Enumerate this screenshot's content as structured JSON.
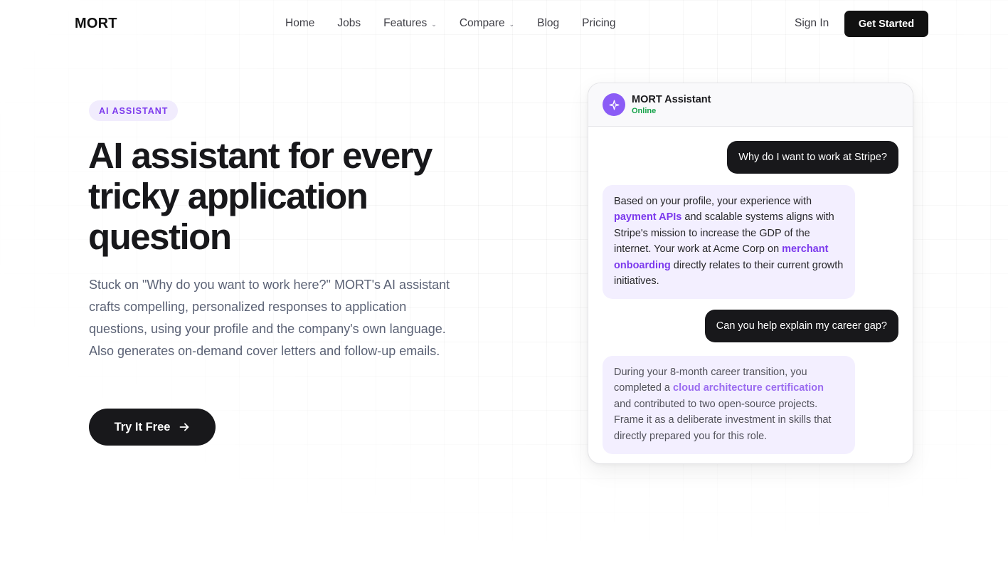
{
  "header": {
    "logo": "MORT",
    "nav": {
      "home": "Home",
      "jobs": "Jobs",
      "features": "Features",
      "compare": "Compare",
      "blog": "Blog",
      "pricing": "Pricing"
    },
    "sign_in": "Sign In",
    "get_started": "Get Started"
  },
  "hero": {
    "badge": "AI ASSISTANT",
    "title": "AI assistant for every tricky application question",
    "description": "Stuck on \"Why do you want to work here?\" MORT's AI assistant crafts compelling, personalized responses to application questions, using your profile and the company's own language. Also generates on-demand cover letters and follow-up emails.",
    "cta": "Try It Free"
  },
  "chat": {
    "assistant_name": "MORT Assistant",
    "status": "Online",
    "messages": [
      {
        "role": "user",
        "text": "Why do I want to work at Stripe?"
      },
      {
        "role": "assistant",
        "parts": {
          "p1": "Based on your profile, your experience with ",
          "h1": "payment APIs",
          "p2": " and scalable systems aligns with Stripe's mission to increase the GDP of the internet. Your work at Acme Corp on ",
          "h2": "merchant onboarding",
          "p3": " directly relates to their current growth initiatives."
        }
      },
      {
        "role": "user",
        "text": "Can you help explain my career gap?"
      },
      {
        "role": "assistant",
        "parts": {
          "p1": "During your 8-month career transition, you completed a ",
          "h1": "cloud architecture certification",
          "p2": " and contributed to two open-source projects. Frame it as a deliberate investment in skills that directly prepared you for this role."
        }
      }
    ]
  },
  "colors": {
    "accent": "#7c3aed",
    "dark": "#18181b",
    "online": "#16a34a",
    "bubble_bg": "#f3efff"
  }
}
